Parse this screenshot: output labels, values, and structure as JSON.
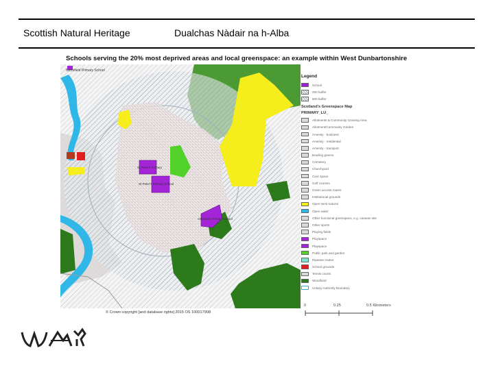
{
  "header": {
    "org_name_en": "Scottish Natural Heritage",
    "org_name_gd": "Dualchas Nàdair na h-Alba"
  },
  "map": {
    "title": "Schools serving the 20% most deprived areas and local greenspace: an example within West Dunbartonshire",
    "copyright": "© Crown copyright [and database rights] 2015 OS 100017908",
    "labels": {
      "map_top_label": "Northfield Primary School",
      "school_a": "St Peter's Primary",
      "school_b": "St Peter's Primary School",
      "school_c": "Aitkenbar Primary School"
    }
  },
  "legend": {
    "title": "Legend",
    "items": [
      {
        "label": "School",
        "color": "#9b1fd6",
        "style": "fill"
      },
      {
        "label": "250 buffer",
        "color": "#ffffff",
        "style": "hatch"
      },
      {
        "label": "500 buffer",
        "color": "#ffffff",
        "style": "hatch"
      }
    ],
    "subtitle": "Scotland's Greenspace Map",
    "field": "PRIMARY_LU_",
    "categories": [
      {
        "label": "Allotments & Community Growing Area",
        "color": "#d9d9d9"
      },
      {
        "label": "Allotment/Community Garden",
        "color": "#d9d9d9"
      },
      {
        "label": "Amenity - business",
        "color": "#d9d9d9"
      },
      {
        "label": "Amenity - residential",
        "color": "#d9d9d9"
      },
      {
        "label": "Amenity - transport",
        "color": "#d9d9d9"
      },
      {
        "label": "Bowling greens",
        "color": "#d9d9d9"
      },
      {
        "label": "Cemetery",
        "color": "#d9d9d9"
      },
      {
        "label": "Churchyard",
        "color": "#d9d9d9"
      },
      {
        "label": "Civic space",
        "color": "#d9d9d9"
      },
      {
        "label": "Golf courses",
        "color": "#d9d9d9"
      },
      {
        "label": "Green access routes",
        "color": "#d9d9d9"
      },
      {
        "label": "Institutional grounds",
        "color": "#d9d9d9"
      },
      {
        "label": "Open semi-natural",
        "color": "#f5ee1c"
      },
      {
        "label": "Open water",
        "color": "#2fb7e8"
      },
      {
        "label": "Other functional greenspace, e.g. caravan site",
        "color": "#d9d9d9"
      },
      {
        "label": "Other sports",
        "color": "#d9d9d9"
      },
      {
        "label": "Playing fields",
        "color": "#d9d9d9"
      },
      {
        "label": "Playspace",
        "color": "#a424d8"
      },
      {
        "label": "Playspace",
        "color": "#a424d8"
      },
      {
        "label": "Public park and garden",
        "color": "#52d12a"
      },
      {
        "label": "Riparian routes",
        "color": "#7fe0d0"
      },
      {
        "label": "School grounds",
        "color": "#e02020"
      },
      {
        "label": "Tennis courts",
        "color": "#d9d9d9"
      },
      {
        "label": "Woodland",
        "color": "#2d7a1c"
      },
      {
        "label": "Unitary Authority Boundary",
        "color": "#3aa6d0",
        "style": "outline"
      }
    ]
  },
  "scale": {
    "zero": "0",
    "mid": "0.25",
    "end": "0.5 Kilometers"
  }
}
